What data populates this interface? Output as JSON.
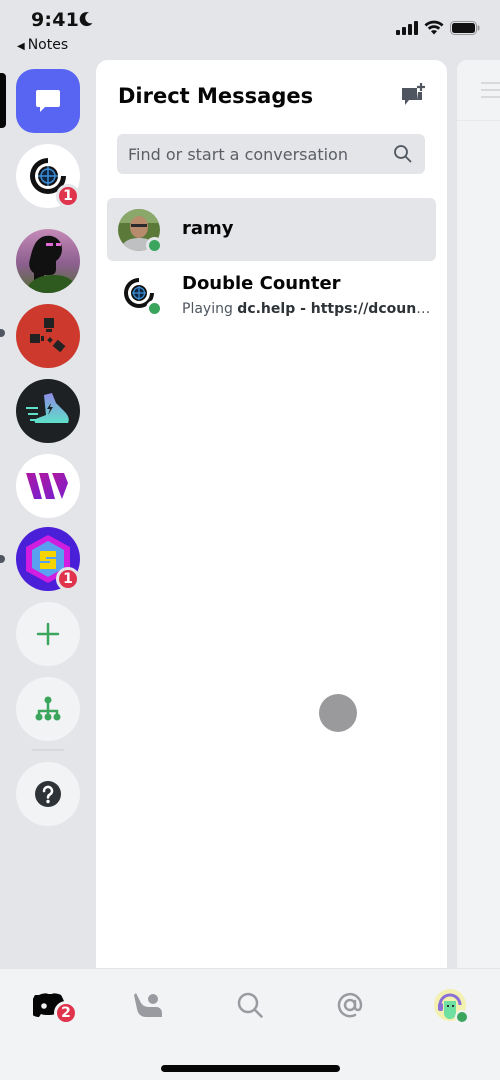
{
  "status_bar": {
    "time": "9:41",
    "back_app": "Notes",
    "icons": [
      "moon-icon",
      "cellular-signal-icon",
      "wifi-icon",
      "battery-icon"
    ]
  },
  "colors": {
    "brand": "#5865f2",
    "online": "#3ba55d",
    "badge": "#e0334c",
    "action_green": "#3ba55d"
  },
  "server_rail": {
    "items": [
      {
        "name": "direct-messages",
        "icon": "chat-bubble-icon",
        "selected": true
      },
      {
        "name": "double-counter-server",
        "icon": "crosshair-logo-icon",
        "badge": "1"
      },
      {
        "name": "pink-avatar-server",
        "icon": "server-avatar"
      },
      {
        "name": "rust-server",
        "icon": "rust-logo-icon",
        "unread": true
      },
      {
        "name": "sneaker-server",
        "icon": "running-shoe-icon"
      },
      {
        "name": "w-server",
        "icon": "w-logo-icon"
      },
      {
        "name": "hex-s-server",
        "icon": "hex-s-logo-icon",
        "unread": true,
        "badge": "1"
      }
    ],
    "actions": [
      {
        "name": "add-server",
        "icon": "plus-icon"
      },
      {
        "name": "explore-servers",
        "icon": "hierarchy-icon"
      },
      {
        "name": "help",
        "icon": "question-icon"
      }
    ]
  },
  "dm_panel": {
    "title": "Direct Messages",
    "new_dm_icon": "new-message-icon",
    "search": {
      "placeholder": "Find or start a conversation",
      "value": ""
    },
    "conversations": [
      {
        "name": "ramy",
        "status_prefix": "",
        "status_detail": "",
        "online": true,
        "active": true
      },
      {
        "name": "Double Counter",
        "status_prefix": "Playing ",
        "status_detail": "dc.help - https://dcounter...",
        "online": true,
        "active": false
      }
    ]
  },
  "tab_bar": {
    "tabs": [
      {
        "name": "home",
        "icon": "discord-logo-icon",
        "badge": "2",
        "active": true
      },
      {
        "name": "friends",
        "icon": "friends-wave-icon"
      },
      {
        "name": "search",
        "icon": "search-icon"
      },
      {
        "name": "mentions",
        "icon": "at-sign-icon"
      },
      {
        "name": "profile",
        "icon": "user-avatar",
        "online": true
      }
    ]
  }
}
